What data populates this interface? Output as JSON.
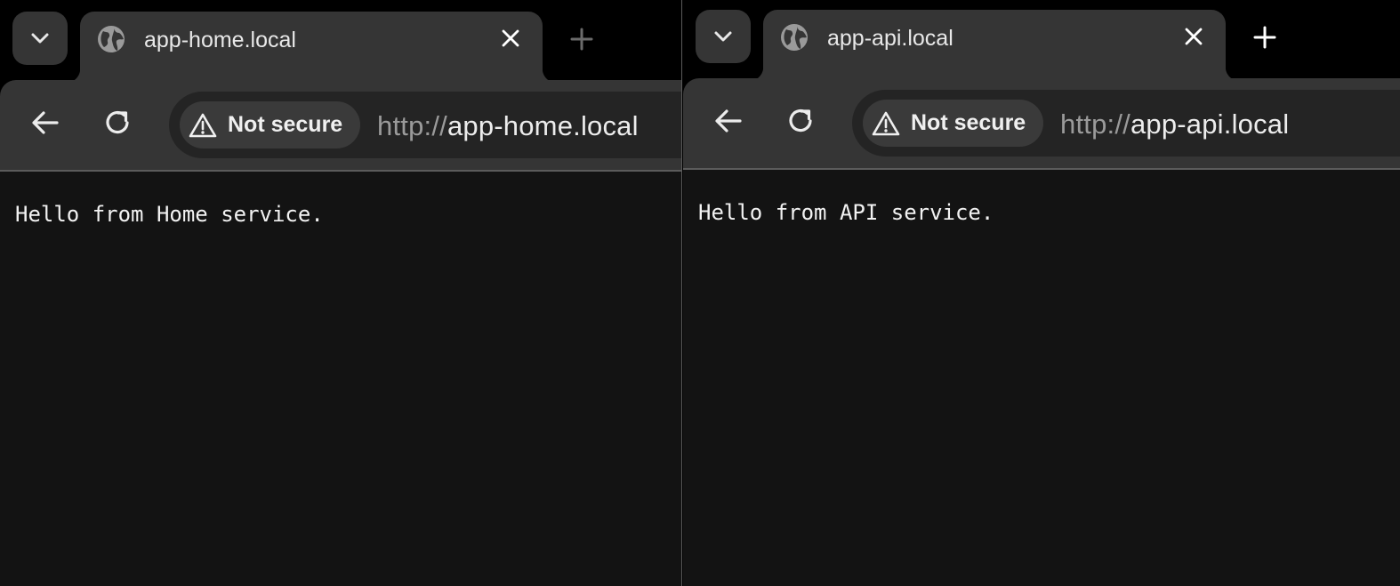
{
  "colors": {
    "frame": "#000000",
    "toolbar": "#353535",
    "omnibox": "#242424",
    "chip": "#3a3a3a",
    "page_background": "#131313",
    "text": "#f2f2f2",
    "muted_text": "#9a9a9a"
  },
  "windows": [
    {
      "tab": {
        "title": "app-home.local",
        "favicon": "globe-icon",
        "close_icon": "close-icon"
      },
      "tab_search_icon": "chevron-down-icon",
      "new_tab_icon": "plus-icon",
      "toolbar": {
        "back_icon": "arrow-left-icon",
        "reload_icon": "reload-icon",
        "security_chip": {
          "icon": "warning-icon",
          "label": "Not secure"
        },
        "url_scheme": "http://",
        "url_host": "app-home.local"
      },
      "page": {
        "text": "Hello from Home service."
      }
    },
    {
      "tab": {
        "title": "app-api.local",
        "favicon": "globe-icon",
        "close_icon": "close-icon"
      },
      "tab_search_icon": "chevron-down-icon",
      "new_tab_icon": "plus-icon",
      "toolbar": {
        "back_icon": "arrow-left-icon",
        "reload_icon": "reload-icon",
        "security_chip": {
          "icon": "warning-icon",
          "label": "Not secure"
        },
        "url_scheme": "http://",
        "url_host": "app-api.local"
      },
      "page": {
        "text": "Hello from API service."
      }
    }
  ]
}
